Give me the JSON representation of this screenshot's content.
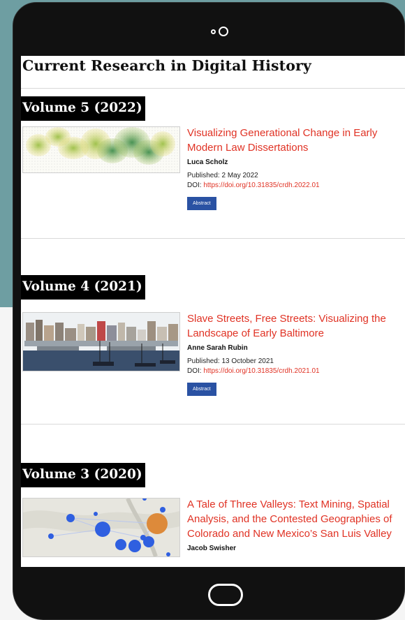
{
  "page": {
    "title": "Current Research in Digital History"
  },
  "volumes": [
    {
      "heading": "Volume 5 (2022)",
      "article": {
        "title": "Visualizing Generational Change in Early Modern Law Dissertations",
        "author": "Luca Scholz",
        "published": "Published: 2 May 2022",
        "doi_label": "DOI:",
        "doi": "https://doi.org/10.31835/crdh.2022.01",
        "abstract_button": "Abstract"
      }
    },
    {
      "heading": "Volume 4 (2021)",
      "article": {
        "title": "Slave Streets, Free Streets: Visualizing the Landscape of Early Baltimore",
        "author": "Anne Sarah Rubin",
        "published": "Published: 13 October 2021",
        "doi_label": "DOI:",
        "doi": "https://doi.org/10.31835/crdh.2021.01",
        "abstract_button": "Abstract"
      }
    },
    {
      "heading": "Volume 3 (2020)",
      "article": {
        "title": "A Tale of Three Valleys: Text Mining, Spatial Analysis, and the Contested Geographies of Colorado and New Mexico’s San Luis Valley",
        "author": "Jacob Swisher"
      }
    }
  ],
  "colors": {
    "accent_link": "#e03224",
    "button": "#2a52a3",
    "background_teal": "#6e9ea2",
    "device": "#111111"
  },
  "icons": [
    "camera-icon",
    "home-button-icon"
  ]
}
